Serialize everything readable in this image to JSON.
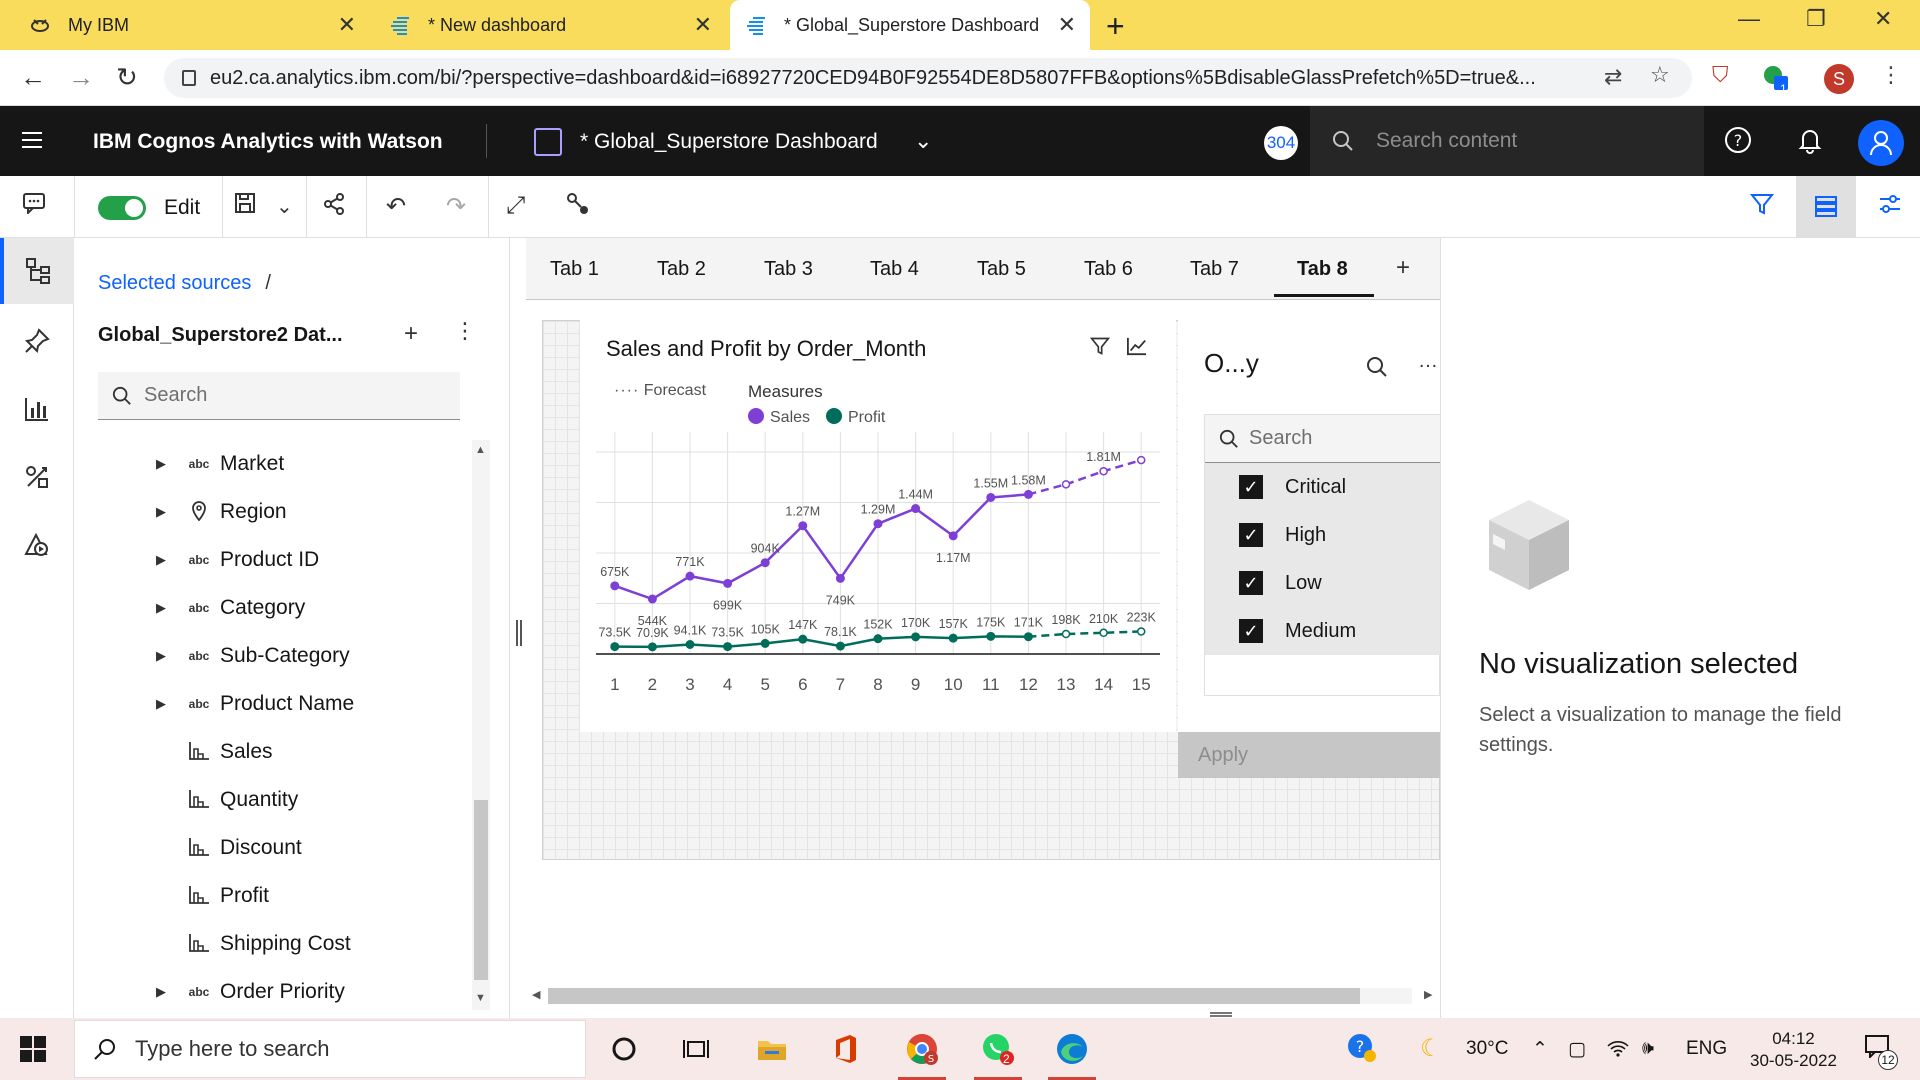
{
  "browser": {
    "tabs": [
      {
        "title": "My IBM",
        "icon": "ibm-bee-icon",
        "active": false
      },
      {
        "title": "* New dashboard",
        "icon": "cognos-icon",
        "active": false
      },
      {
        "title": "* Global_Superstore Dashboard",
        "icon": "cognos-icon",
        "active": true
      }
    ],
    "url": "eu2.ca.analytics.ibm.com/bi/?perspective=dashboard&id=i68927720CED94B0F92554DE8D5807FFB&options%5BdisableGlassPrefetch%5D=true&...",
    "profile_initial": "S",
    "extension_badge": "1"
  },
  "app": {
    "brand": "IBM Cognos Analytics with Watson",
    "dashboard_title": "* Global_Superstore Dashboard",
    "badge": "304",
    "search_placeholder": "Search content"
  },
  "toolbar": {
    "edit_label": "Edit"
  },
  "data_panel": {
    "breadcrumb": "Selected sources",
    "breadcrumb_sep": "/",
    "source_title": "Global_Superstore2 Dat...",
    "search_placeholder": "Search",
    "items": [
      {
        "label": "Market",
        "type": "abc",
        "expandable": true
      },
      {
        "label": "Region",
        "type": "geo",
        "expandable": true
      },
      {
        "label": "Product ID",
        "type": "abc",
        "expandable": true
      },
      {
        "label": "Category",
        "type": "abc",
        "expandable": true
      },
      {
        "label": "Sub-Category",
        "type": "abc",
        "expandable": true
      },
      {
        "label": "Product Name",
        "type": "abc",
        "expandable": true
      },
      {
        "label": "Sales",
        "type": "measure",
        "expandable": false
      },
      {
        "label": "Quantity",
        "type": "measure",
        "expandable": false
      },
      {
        "label": "Discount",
        "type": "measure",
        "expandable": false
      },
      {
        "label": "Profit",
        "type": "measure",
        "expandable": false
      },
      {
        "label": "Shipping Cost",
        "type": "measure",
        "expandable": false
      },
      {
        "label": "Order Priority",
        "type": "abc",
        "expandable": true
      }
    ]
  },
  "dashboard_tabs": [
    "Tab 1",
    "Tab 2",
    "Tab 3",
    "Tab 4",
    "Tab 5",
    "Tab 6",
    "Tab 7",
    "Tab 8"
  ],
  "active_tab": "Tab 8",
  "chart_widget": {
    "title": "Sales and Profit by Order_Month",
    "legend_forecast": "Forecast",
    "legend_measures": "Measures",
    "legend_sales": "Sales",
    "legend_profit": "Profit"
  },
  "chart_data": {
    "type": "line",
    "title": "Sales and Profit by Order_Month",
    "x": [
      1,
      2,
      3,
      4,
      5,
      6,
      7,
      8,
      9,
      10,
      11,
      12,
      13,
      14,
      15
    ],
    "forecast_from_index": 12,
    "series": [
      {
        "name": "Sales",
        "color": "#7d3fd6",
        "values": [
          675000,
          544000,
          771000,
          699000,
          904000,
          1270000,
          749000,
          1290000,
          1440000,
          1170000,
          1550000,
          1580000,
          1680000,
          1810000,
          1920000
        ],
        "labels": [
          "675K",
          "544K",
          "771K",
          "699K",
          "904K",
          "1.27M",
          "749K",
          "1.29M",
          "1.44M",
          "1.17M",
          "1.55M",
          "1.58M",
          "",
          "1.81M",
          ""
        ]
      },
      {
        "name": "Profit",
        "color": "#006d5b",
        "values": [
          73500,
          70900,
          94100,
          73500,
          105000,
          147000,
          78100,
          152000,
          170000,
          157000,
          175000,
          171000,
          198000,
          210000,
          223000
        ],
        "labels": [
          "73.5K",
          "70.9K",
          "94.1K",
          "73.5K",
          "105K",
          "147K",
          "78.1K",
          "152K",
          "170K",
          "157K",
          "175K",
          "171K",
          "198K",
          "210K",
          "223K"
        ]
      }
    ],
    "ylim": [
      0,
      2000000
    ],
    "grid": true,
    "legend": "top-left"
  },
  "filter_widget": {
    "title": "O...y",
    "search_placeholder": "Search",
    "options": [
      {
        "label": "Critical",
        "checked": true
      },
      {
        "label": "High",
        "checked": true
      },
      {
        "label": "Low",
        "checked": true
      },
      {
        "label": "Medium",
        "checked": true
      }
    ],
    "apply_label": "Apply"
  },
  "properties": {
    "title": "No visualization selected",
    "description": "Select a visualization to manage the field settings."
  },
  "taskbar": {
    "search_placeholder": "Type here to search",
    "temperature": "30°C",
    "language": "ENG",
    "time": "04:12",
    "date": "30-05-2022",
    "notification_count": "12",
    "whatsapp_badge": "2"
  }
}
